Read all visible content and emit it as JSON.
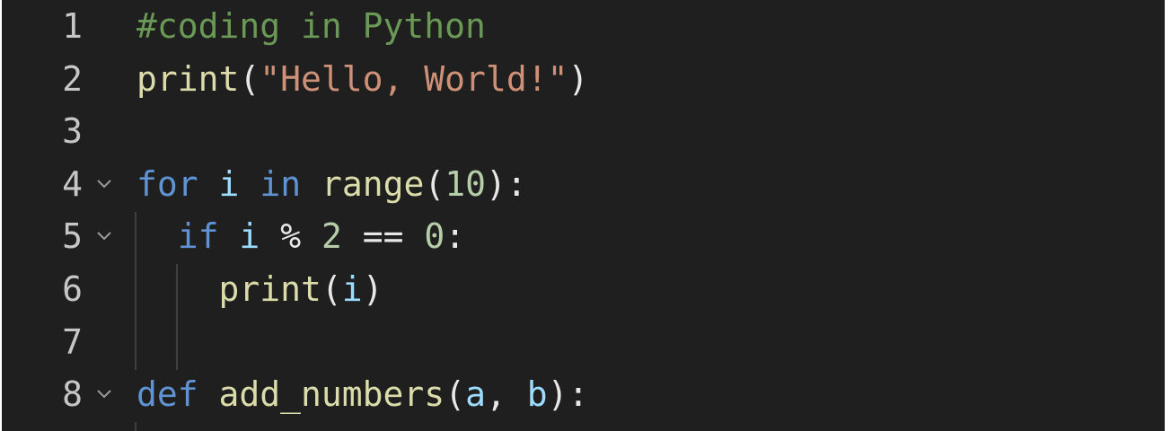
{
  "editor": {
    "language": "Python",
    "colors": {
      "background": "#1f1f1f",
      "line_number": "#c6c6c6",
      "comment": "#6a9955",
      "function": "#dcdcaa",
      "string": "#ce9178",
      "keyword": "#5f93d3",
      "variable": "#9cdcfe",
      "number": "#b5cea8"
    },
    "lines": [
      {
        "number": "1",
        "foldable": false,
        "tokens": [
          {
            "text": "#coding in Python",
            "kind": "comment"
          }
        ]
      },
      {
        "number": "2",
        "foldable": false,
        "tokens": [
          {
            "text": "print",
            "kind": "func"
          },
          {
            "text": "(",
            "kind": "plain"
          },
          {
            "text": "\"Hello, World!\"",
            "kind": "string"
          },
          {
            "text": ")",
            "kind": "plain"
          }
        ]
      },
      {
        "number": "3",
        "foldable": false,
        "tokens": []
      },
      {
        "number": "4",
        "foldable": true,
        "tokens": [
          {
            "text": "for",
            "kind": "keyword"
          },
          {
            "text": " ",
            "kind": "plain"
          },
          {
            "text": "i",
            "kind": "var"
          },
          {
            "text": " ",
            "kind": "plain"
          },
          {
            "text": "in",
            "kind": "keyword"
          },
          {
            "text": " ",
            "kind": "plain"
          },
          {
            "text": "range",
            "kind": "func"
          },
          {
            "text": "(",
            "kind": "plain"
          },
          {
            "text": "10",
            "kind": "number"
          },
          {
            "text": "):",
            "kind": "plain"
          }
        ]
      },
      {
        "number": "5",
        "foldable": true,
        "tokens": [
          {
            "text": "  ",
            "kind": "plain"
          },
          {
            "text": "if",
            "kind": "keyword"
          },
          {
            "text": " ",
            "kind": "plain"
          },
          {
            "text": "i",
            "kind": "var"
          },
          {
            "text": " % ",
            "kind": "plain"
          },
          {
            "text": "2",
            "kind": "number"
          },
          {
            "text": " == ",
            "kind": "plain"
          },
          {
            "text": "0",
            "kind": "number"
          },
          {
            "text": ":",
            "kind": "plain"
          }
        ]
      },
      {
        "number": "6",
        "foldable": false,
        "tokens": [
          {
            "text": "    ",
            "kind": "plain"
          },
          {
            "text": "print",
            "kind": "func"
          },
          {
            "text": "(",
            "kind": "plain"
          },
          {
            "text": "i",
            "kind": "var"
          },
          {
            "text": ")",
            "kind": "plain"
          }
        ]
      },
      {
        "number": "7",
        "foldable": false,
        "tokens": []
      },
      {
        "number": "8",
        "foldable": true,
        "tokens": [
          {
            "text": "def",
            "kind": "keyword"
          },
          {
            "text": " ",
            "kind": "plain"
          },
          {
            "text": "add_numbers",
            "kind": "func"
          },
          {
            "text": "(",
            "kind": "plain"
          },
          {
            "text": "a",
            "kind": "var"
          },
          {
            "text": ", ",
            "kind": "plain"
          },
          {
            "text": "b",
            "kind": "var"
          },
          {
            "text": "):",
            "kind": "plain"
          }
        ]
      }
    ],
    "fold_icon": "chevron-down-icon"
  }
}
